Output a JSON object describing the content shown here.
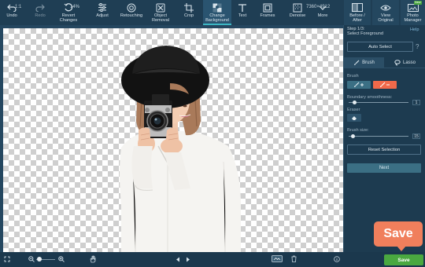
{
  "toolbar": {
    "undo": "Undo",
    "redo": "Redo",
    "revert": "Revert\nChanges",
    "adjust": "Adjust",
    "retouching": "Retouching",
    "object_removal": "Object\nRemoval",
    "crop": "Crop",
    "change_background": "Change\nBackground",
    "text": "Text",
    "frames": "Frames",
    "denoise": "Denoise",
    "more": "More",
    "before_after": "Before /\nAfter",
    "view_original": "View\nOriginal",
    "photo_manager": "Photo\nManager",
    "new_badge": "New"
  },
  "panel": {
    "step_line1": "Step 1/3:",
    "step_line2": "Select Foreground",
    "help": "Help",
    "auto_select": "Auto Select",
    "tab_brush": "Brush",
    "tab_lasso": "Lasso",
    "brush_label": "Brush",
    "boundary_label": "Boundary smoothness:",
    "boundary_value": "1",
    "eraser_label": "Eraser",
    "brush_size_label": "Brush size:",
    "brush_size_value": "15",
    "reset_selection": "Reset Selection",
    "next": "Next"
  },
  "status": {
    "fit": "1:1",
    "zoom": "14%",
    "dimensions": "7360×4912",
    "save": "Save"
  },
  "callout": {
    "text": "Save"
  },
  "colors": {
    "accent_teal": "#3cb7c4",
    "add_brush": "#3b6f84",
    "remove_brush": "#f0694a",
    "save_green": "#4aa840",
    "callout_orange": "#f07f5c"
  }
}
